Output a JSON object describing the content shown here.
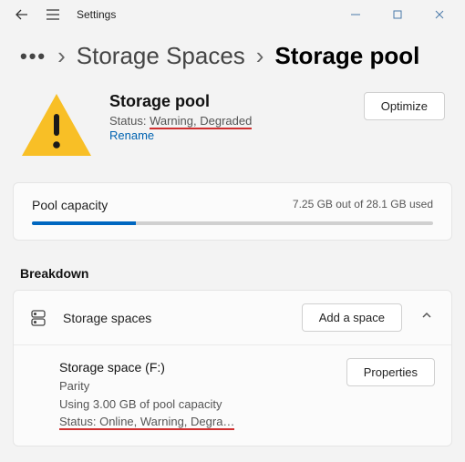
{
  "app": {
    "name": "Settings"
  },
  "breadcrumb": {
    "parent": "Storage Spaces",
    "current": "Storage pool"
  },
  "pool": {
    "title": "Storage pool",
    "status_prefix": "Status: ",
    "status_value": "Warning, Degraded ",
    "rename_label": "Rename",
    "optimize_label": "Optimize"
  },
  "capacity": {
    "label": "Pool capacity",
    "usage_text": "7.25 GB out of 28.1 GB used"
  },
  "breakdown": {
    "section": "Breakdown",
    "header_label": "Storage spaces",
    "add_label": "Add a space",
    "item": {
      "name": "Storage space (F:)",
      "resiliency": "Parity",
      "usage": "Using 3.00 GB of pool capacity",
      "status": "Status: Online, Warning, Degra…",
      "properties_label": "Properties"
    }
  }
}
